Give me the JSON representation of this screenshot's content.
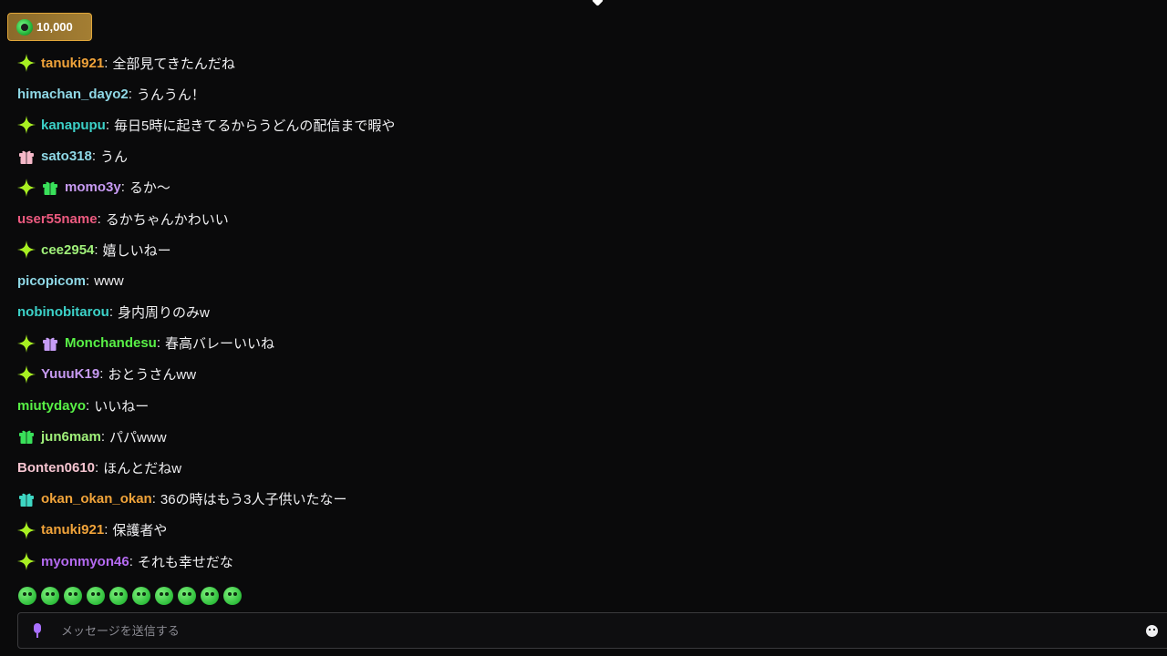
{
  "points": {
    "value": "10,000"
  },
  "colors": {
    "verified": "#a8f022",
    "gift_pink": "#f5b8c8",
    "gift_green": "#39e05a",
    "gift_teal": "#3ed7c3",
    "gift_purple": "#c69cf5"
  },
  "messages": [
    {
      "user": "tanuki921",
      "color": "#f0a33a",
      "text": "全部見てきたんだね",
      "badges": [
        "verified"
      ]
    },
    {
      "user": "himachan_dayo2",
      "color": "#8fd8e6",
      "text": "うんうん！",
      "badges": []
    },
    {
      "user": "kanapupu",
      "color": "#3cd1c8",
      "text": "毎日5時に起きてるからうどんの配信まで暇や",
      "badges": [
        "verified"
      ]
    },
    {
      "user": "sato318",
      "color": "#8fd8e6",
      "text": "うん",
      "badges": [
        "gift_pink"
      ]
    },
    {
      "user": "momo3y",
      "color": "#c79af2",
      "text": "るか〜",
      "badges": [
        "verified",
        "gift_green"
      ]
    },
    {
      "user": "user55name",
      "color": "#ec5a7f",
      "text": "るかちゃんかわいい",
      "badges": []
    },
    {
      "user": "cee2954",
      "color": "#a0f07a",
      "text": "嬉しいねー",
      "badges": [
        "verified"
      ]
    },
    {
      "user": "picopicom",
      "color": "#8fd8e6",
      "text": "www",
      "badges": []
    },
    {
      "user": "nobinobitarou",
      "color": "#3cd1c8",
      "text": "身内周りのみw",
      "badges": []
    },
    {
      "user": "Monchandesu",
      "color": "#58f046",
      "text": "春高バレーいいね",
      "badges": [
        "verified",
        "gift_purple"
      ]
    },
    {
      "user": "YuuuK19",
      "color": "#c79af2",
      "text": "おとうさんww",
      "badges": [
        "verified"
      ]
    },
    {
      "user": "miutydayo",
      "color": "#58f046",
      "text": "いいねー",
      "badges": []
    },
    {
      "user": "jun6mam",
      "color": "#a0f07a",
      "text": "パパwww",
      "badges": [
        "gift_green"
      ]
    },
    {
      "user": "Bonten0610",
      "color": "#f5c4d0",
      "text": "ほんとだねw",
      "badges": []
    },
    {
      "user": "okan_okan_okan",
      "color": "#f0a33a",
      "text": "36の時はもう3人子供いたなー",
      "badges": [
        "gift_teal"
      ]
    },
    {
      "user": "tanuki921",
      "color": "#f0a33a",
      "text": "保護者や",
      "badges": [
        "verified"
      ]
    },
    {
      "user": "myonmyon46",
      "color": "#b46af0",
      "text": "それも幸せだな",
      "badges": [
        "verified"
      ]
    }
  ],
  "emotes": [
    "emote-1",
    "emote-2",
    "emote-3",
    "emote-4",
    "emote-5",
    "emote-6",
    "emote-7",
    "emote-8",
    "emote-9",
    "emote-10"
  ],
  "input": {
    "placeholder": "メッセージを送信する"
  }
}
